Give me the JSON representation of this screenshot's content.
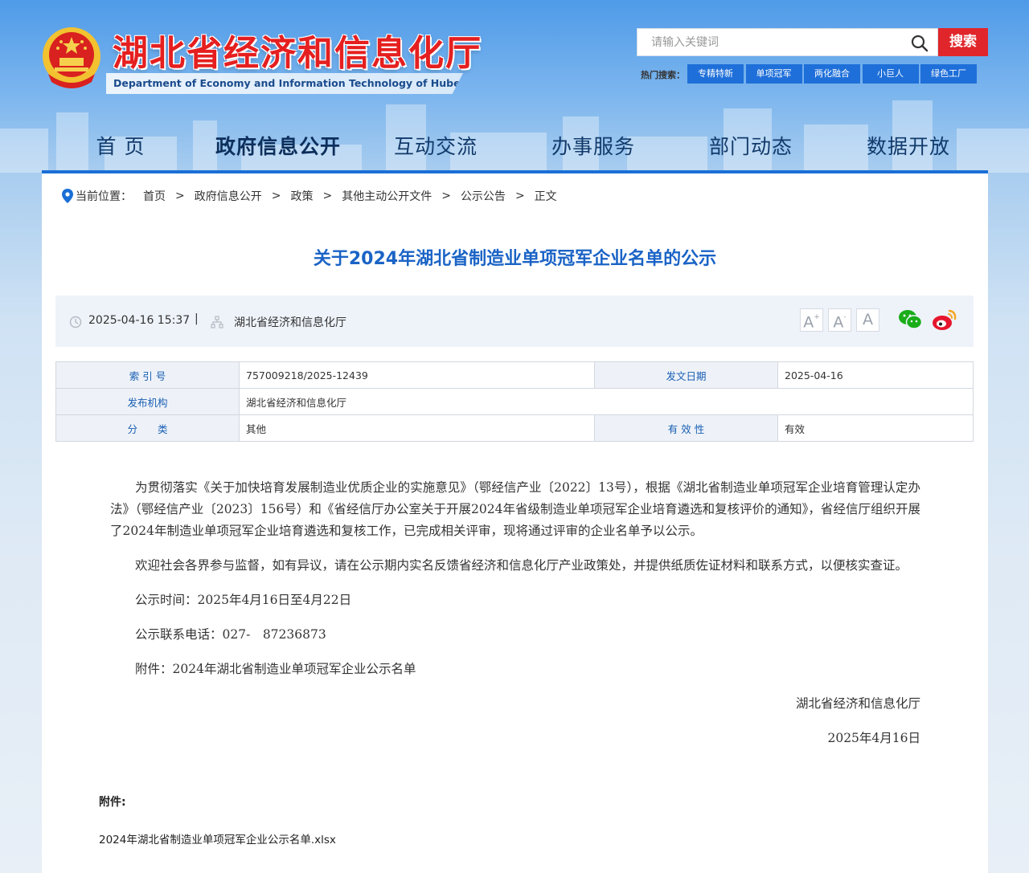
{
  "header": {
    "title": "湖北省经济和信息化厅",
    "subtitle": "Department of Economy and Information Technology of Hubei Province",
    "search_placeholder": "请输入关键词",
    "search_button": "搜索",
    "hot_label": "热门搜索：",
    "hot_tags": [
      "专精特新",
      "单项冠军",
      "两化融合",
      "小巨人",
      "绿色工厂"
    ]
  },
  "nav": {
    "items": [
      "首 页",
      "政府信息公开",
      "互动交流",
      "办事服务",
      "部门动态",
      "数据开放"
    ],
    "active": "政府信息公开"
  },
  "breadcrumb": {
    "label": "当前位置：",
    "items": [
      "首页",
      "政府信息公开",
      "政策",
      "其他主动公开文件",
      "公示公告",
      "正文"
    ],
    "separator": ">"
  },
  "article": {
    "title": "关于2024年湖北省制造业单项冠军企业名单的公示",
    "date": "2025-04-16 15:37",
    "meta_sep": "|",
    "source": "湖北省经济和信息化厅",
    "font_buttons": [
      "A+",
      "A",
      "A"
    ]
  },
  "info": {
    "index_label": "索 引 号",
    "index_value": "757009218/2025-12439",
    "date_label": "发文日期",
    "date_value": "2025-04-16",
    "org_label": "发布机构",
    "org_value": "湖北省经济和信息化厅",
    "category_label": "分　　类",
    "category_value": "其他",
    "validity_label": "有 效 性",
    "validity_value": "有效"
  },
  "body": {
    "p1": "为贯彻落实《关于加快培育发展制造业优质企业的实施意见》（鄂经信产业〔2022〕13号），根据《湖北省制造业单项冠军企业培育管理认定办法》（鄂经信产业〔2023〕156号）和《省经信厅办公室关于开展2024年省级制造业单项冠军企业培育遴选和复核评价的通知》，省经信厅组织开展了2024年制造业单项冠军企业培育遴选和复核工作，已完成相关评审，现将通过评审的企业名单予以公示。",
    "p2": "欢迎社会各界参与监督，如有异议，请在公示期内实名反馈省经济和信息化厅产业政策处，并提供纸质佐证材料和联系方式，以便核实查证。",
    "p3": "公示时间：2025年4月16日至4月22日",
    "p4": "公示联系电话：027-　87236873",
    "p5": "附件：2024年湖北省制造业单项冠军企业公示名单",
    "sign_org": "湖北省经济和信息化厅",
    "sign_date": "2025年4月16日"
  },
  "attachment": {
    "title": "附件:",
    "file": "2024年湖北省制造业单项冠军企业公示名单.xlsx"
  },
  "colors": {
    "accent_blue": "#1a6fd6",
    "title_red": "#e51f1f",
    "search_red": "#e0262b"
  }
}
